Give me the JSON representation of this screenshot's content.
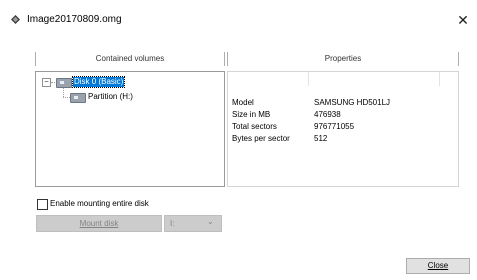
{
  "window": {
    "title": "Image20170809.omg",
    "close_glyph": "✕",
    "icon": "diamond-app-icon"
  },
  "left_panel": {
    "header": "Contained volumes",
    "tree": [
      {
        "label": "Disk 0 (Basic)",
        "selected": true,
        "expanded": true,
        "icon": "hard-disk-icon",
        "expander": "−"
      },
      {
        "label": "Partition (H:)",
        "selected": false,
        "icon": "hard-disk-icon"
      }
    ]
  },
  "right_panel": {
    "header": "Properties",
    "rows": [
      {
        "key": "Model",
        "value": "SAMSUNG HD501LJ"
      },
      {
        "key": "Size in MB",
        "value": "476938"
      },
      {
        "key": "Total sectors",
        "value": "976771055"
      },
      {
        "key": "Bytes per sector",
        "value": "512"
      }
    ]
  },
  "mount": {
    "checkbox_label": "Enable mounting entire disk",
    "checked": false,
    "mount_button": "Mount disk",
    "drive_letter": "I:",
    "dropdown_arrow": "⌄"
  },
  "footer": {
    "close_button": "Close"
  },
  "colors": {
    "selection": "#0078d7",
    "disabled_bg": "#cccccc",
    "button_bg": "#e1e1e1"
  }
}
